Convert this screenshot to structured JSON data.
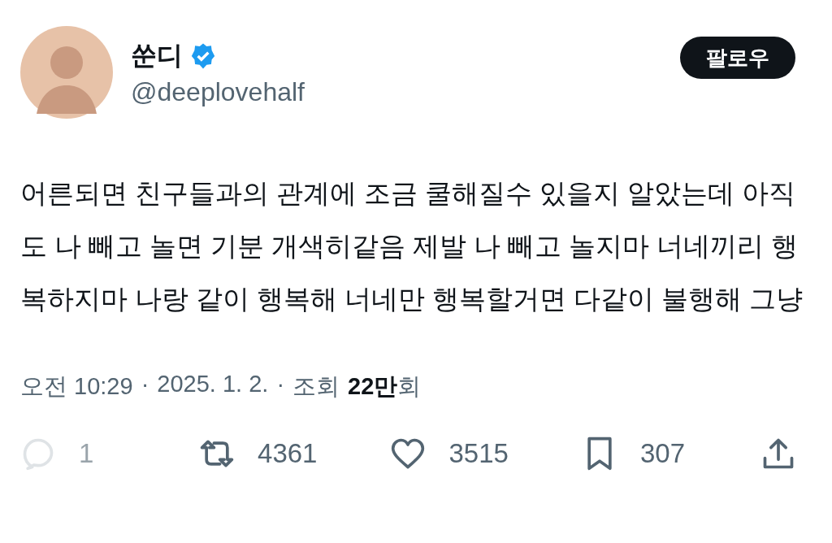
{
  "author": {
    "name": "쑨디",
    "verified": true,
    "handle": "@deeplovehalf"
  },
  "follow_button": {
    "label": "팔로우"
  },
  "text": "어른되면 친구들과의 관계에 조금 쿨해질수 있을지 알았는데 아직도 나 빼고 놀면 기분 개색히같음 제발 나 빼고 놀지마 너네끼리 행복하지마 나랑 같이 행복해 너네만 행복할거면 다같이 불행해 그냥",
  "meta": {
    "time": "오전 10:29",
    "separator_1": "·",
    "date": "2025. 1. 2.",
    "separator_2": "·",
    "views_label": "조회",
    "views": "**22만**회"
  },
  "actions": [
    {
      "kind": "reply",
      "count": "1",
      "disabled": true
    },
    {
      "kind": "retweet",
      "count": "4361",
      "disabled": false
    },
    {
      "kind": "like",
      "count": "3515",
      "disabled": false
    },
    {
      "kind": "bookmark",
      "count": "307",
      "disabled": false
    },
    {
      "kind": "share",
      "disabled": false
    }
  ]
}
